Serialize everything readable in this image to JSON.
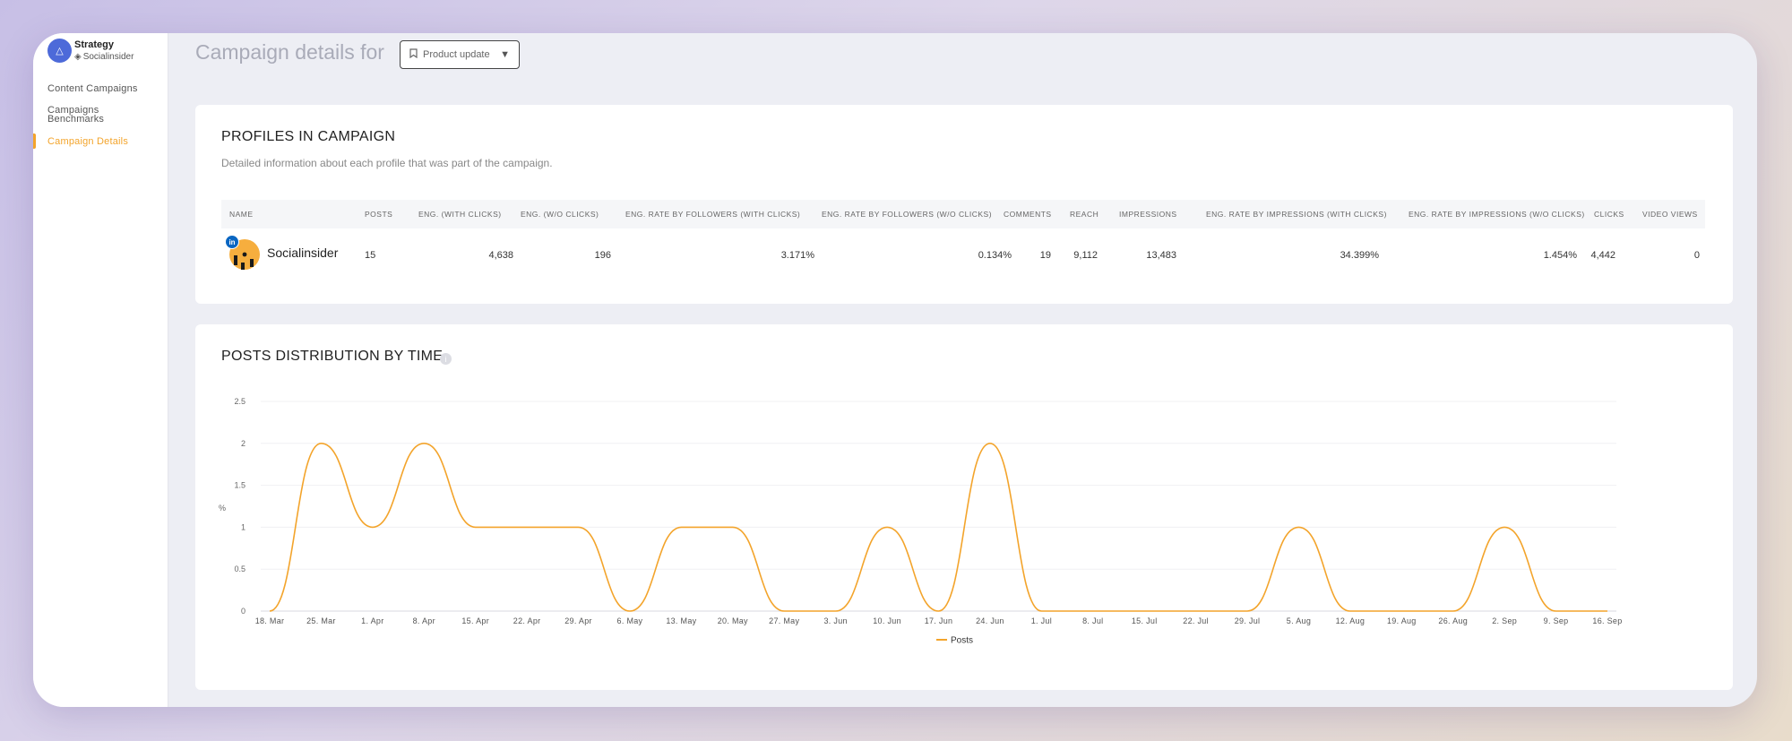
{
  "brand": {
    "title": "Strategy",
    "subtitle": "Socialinsider",
    "avatar_icon": "strategy-icon",
    "sub_icon": "layers-icon"
  },
  "sidebar": {
    "items": [
      {
        "label": "Content Campaigns",
        "active": false
      },
      {
        "label": "Campaigns Benchmarks",
        "active": false
      },
      {
        "label": "Campaign Details",
        "active": true
      }
    ]
  },
  "header": {
    "title": "Campaign details for",
    "campaign_select": {
      "value": "Product update",
      "icon": "bookmark-icon"
    }
  },
  "profiles": {
    "title": "PROFILES IN CAMPAIGN",
    "description": "Detailed information about each profile that was part of the campaign.",
    "columns": [
      "NAME",
      "POSTS",
      "ENG. (WITH CLICKS)",
      "ENG. (W/O CLICKS)",
      "ENG. RATE BY FOLLOWERS (WITH CLICKS)",
      "ENG. RATE BY FOLLOWERS (W/O CLICKS)",
      "COMMENTS",
      "REACH",
      "IMPRESSIONS",
      "ENG. RATE BY IMPRESSIONS (WITH CLICKS)",
      "ENG. RATE BY IMPRESSIONS (W/O CLICKS)",
      "CLICKS",
      "VIDEO VIEWS"
    ],
    "rows": [
      {
        "name": "Socialinsider",
        "network": "in",
        "values": [
          "15",
          "4,638",
          "196",
          "3.171%",
          "0.134%",
          "19",
          "9,112",
          "13,483",
          "34.399%",
          "1.454%",
          "4,442",
          "0"
        ]
      }
    ]
  },
  "posts_chart": {
    "title": "POSTS DISTRIBUTION BY TIME",
    "ylabel": "%",
    "legend": "Posts",
    "color": "#f3a42b"
  },
  "chart_data": {
    "type": "line",
    "title": "POSTS DISTRIBUTION BY TIME",
    "ylabel": "%",
    "ylim": [
      0,
      2.5
    ],
    "yticks": [
      "0",
      "0.5",
      "1",
      "1.5",
      "2",
      "2.5"
    ],
    "grid": true,
    "legend_position": "bottom",
    "categories": [
      "18. Mar",
      "25. Mar",
      "1. Apr",
      "8. Apr",
      "15. Apr",
      "22. Apr",
      "29. Apr",
      "6. May",
      "13. May",
      "20. May",
      "27. May",
      "3. Jun",
      "10. Jun",
      "17. Jun",
      "24. Jun",
      "1. Jul",
      "8. Jul",
      "15. Jul",
      "22. Jul",
      "29. Jul",
      "5. Aug",
      "12. Aug",
      "19. Aug",
      "26. Aug",
      "2. Sep",
      "9. Sep",
      "16. Sep"
    ],
    "series": [
      {
        "name": "Posts",
        "values": [
          0,
          2,
          1,
          2,
          1,
          1,
          1,
          0,
          1,
          1,
          0,
          0,
          1,
          0,
          2,
          0,
          0,
          0,
          0,
          0,
          1,
          0,
          0,
          0,
          1,
          0,
          0
        ]
      }
    ]
  }
}
